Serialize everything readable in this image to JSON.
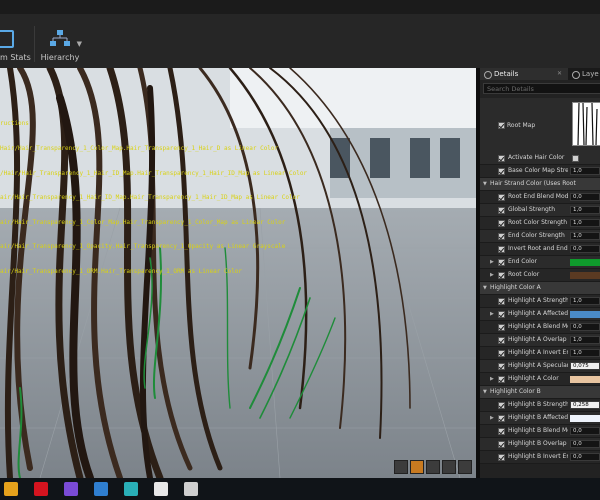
{
  "toolbar": {
    "stats_label": "m Stats",
    "hierarchy_label": "Hierarchy"
  },
  "viewport": {
    "log_lines": [
      "ructions",
      "Hair/Hair_Transparency_1_Color_Map.Hair_Transparency_1_Hair_D as Linear Color",
      "/Hair/Hair_Transparency_1_Hair_ID_Map.Hair_Transparency_1_Hair_ID_Map as Linear Color",
      "air/Hair_Transparency_1_Hair_ID_Map.Hair_Transparency_1_Hair_ID_Map as Linear Color",
      "air/Hair_Transparency_1_Color_Map.Hair_Transparency_1_Color_Map as Linear Color",
      "air/Hair_Transparency_1_Opacity.Hair_Transparency_1_Opacity as Linear Grayscale",
      "air/Hair_Transparency_1_ORM.Hair_Transparency_1_ORM as Linear Color"
    ],
    "tools": [
      "perspective-icon",
      "lit-icon",
      "show-icon",
      "camera-icon",
      "layout-icon"
    ]
  },
  "panel": {
    "tabs": [
      {
        "label": "Details",
        "close": "✕"
      },
      {
        "label": "Laye"
      }
    ],
    "search_placeholder": "Search Details",
    "root_map_label": "Root Map",
    "rows": [
      {
        "type": "prop",
        "label": "Activate Hair Color",
        "kind": "check",
        "checked": true
      },
      {
        "type": "prop",
        "label": "Base Color Map Streng",
        "kind": "value",
        "value": "1,0"
      },
      {
        "type": "cat",
        "label": "Hair Strand Color (Uses Root"
      },
      {
        "type": "prop",
        "label": "Root End Blend Mode",
        "kind": "value",
        "value": "0,0"
      },
      {
        "type": "prop",
        "label": "Global Strength",
        "kind": "value",
        "value": "1,0"
      },
      {
        "type": "prop",
        "label": "Root Color Strength",
        "kind": "value",
        "value": "1,0"
      },
      {
        "type": "prop",
        "label": "End Color Strength",
        "kind": "value",
        "value": "1,0"
      },
      {
        "type": "prop",
        "label": "Invert Root and End Col",
        "kind": "value",
        "value": "0,0"
      },
      {
        "type": "prop",
        "label": "End Color",
        "kind": "color",
        "color": "#0f9a2c",
        "expandable": true
      },
      {
        "type": "prop",
        "label": "Root Color",
        "kind": "color",
        "color": "#5a3a22",
        "expandable": true
      },
      {
        "type": "cat",
        "label": "Highlight Color A"
      },
      {
        "type": "prop",
        "label": "Highlight A Strength",
        "kind": "value",
        "value": "1,0"
      },
      {
        "type": "prop",
        "label": "Highlight A Affected Ra",
        "kind": "color",
        "color": "#4a8ac6",
        "expandable": true
      },
      {
        "type": "prop",
        "label": "Highlight A Blend Mode",
        "kind": "value",
        "value": "0,0"
      },
      {
        "type": "prop",
        "label": "Highlight A Overlap End",
        "kind": "value",
        "value": "1,0"
      },
      {
        "type": "prop",
        "label": "Highlight A Invert End S",
        "kind": "value",
        "value": "1,0"
      },
      {
        "type": "prop",
        "label": "Highlight A Specular St",
        "kind": "value",
        "value": "0,075",
        "white": true
      },
      {
        "type": "prop",
        "label": "Highlight A Color",
        "kind": "color",
        "color": "#e8c4a0",
        "expandable": true
      },
      {
        "type": "cat",
        "label": "Highlight Color B"
      },
      {
        "type": "prop",
        "label": "Highlight B Strength",
        "kind": "value",
        "value": "0,258",
        "white": true
      },
      {
        "type": "prop",
        "label": "Highlight B Affected Ra",
        "kind": "color",
        "color": "#eef3fb",
        "expandable": true
      },
      {
        "type": "prop",
        "label": "Highlight B Blend Mode",
        "kind": "value",
        "value": "0,0"
      },
      {
        "type": "prop",
        "label": "Highlight B Overlap End",
        "kind": "value",
        "value": "0,0"
      },
      {
        "type": "prop",
        "label": "Highlight B Invert End S",
        "kind": "value",
        "value": "0,0"
      }
    ]
  },
  "taskbar": {
    "apps": [
      {
        "name": "chrome-icon",
        "color": "#e6a21c"
      },
      {
        "name": "opera-icon",
        "color": "#d5141f"
      },
      {
        "name": "media-icon",
        "color": "#7a4bd6"
      },
      {
        "name": "photos-icon",
        "color": "#2f7fd0"
      },
      {
        "name": "editor-icon",
        "color": "#2ab0b8"
      },
      {
        "name": "unreal-icon",
        "color": "#e8e8e8"
      },
      {
        "name": "box-icon",
        "color": "#cfcfcf"
      }
    ]
  }
}
